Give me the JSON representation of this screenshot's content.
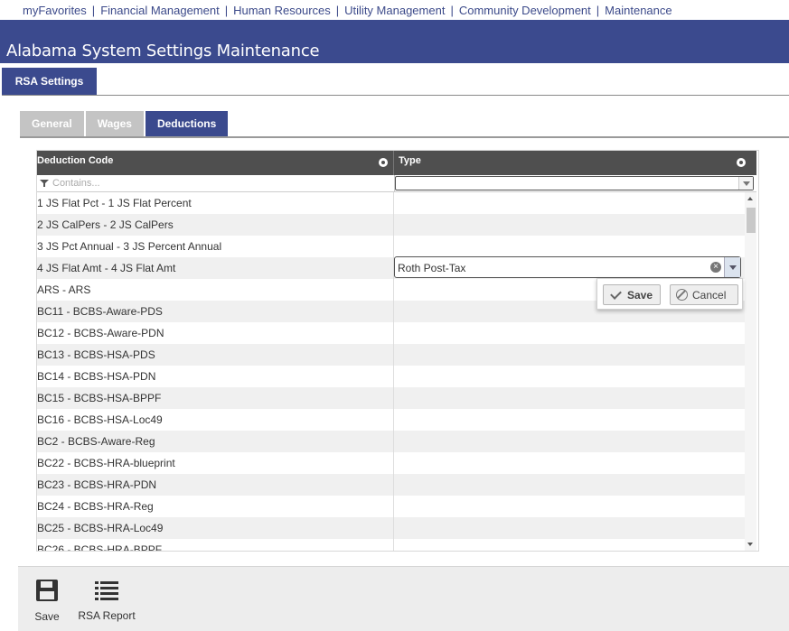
{
  "topnav": {
    "items": [
      "myFavorites",
      "Financial Management",
      "Human Resources",
      "Utility Management",
      "Community Development",
      "Maintenance"
    ],
    "separator": "|"
  },
  "page_title": "Alabama System Settings Maintenance",
  "main_tab": "RSA Settings",
  "subtabs": {
    "general": "General",
    "wages": "Wages",
    "deductions": "Deductions",
    "active": "Deductions"
  },
  "grid": {
    "columns": {
      "code": "Deduction Code",
      "type": "Type"
    },
    "filter_placeholder": "Contains...",
    "rows": [
      "1 JS Flat Pct - 1 JS Flat Percent",
      "2 JS CalPers - 2 JS CalPers",
      "3 JS Pct Annual - 3 JS Percent Annual",
      "4 JS Flat Amt - 4 JS Flat Amt",
      "ARS - ARS",
      "BC11 - BCBS-Aware-PDS",
      "BC12 - BCBS-Aware-PDN",
      "BC13 - BCBS-HSA-PDS",
      "BC14 - BCBS-HSA-PDN",
      "BC15 - BCBS-HSA-BPPF",
      "BC16 - BCBS-HSA-Loc49",
      "BC2 - BCBS-Aware-Reg",
      "BC22 - BCBS-HRA-blueprint",
      "BC23 - BCBS-HRA-PDN",
      "BC24 - BCBS-HRA-Reg",
      "BC25 - BCBS-HRA-Loc49",
      "BC26 - BCBS-HRA-BPPF"
    ]
  },
  "editor": {
    "value": "Roth Post-Tax",
    "clear_symbol": "×",
    "save_label": "Save",
    "cancel_label": "Cancel"
  },
  "toolbar": {
    "save_label": "Save",
    "report_label": "RSA Report"
  },
  "colors": {
    "brand": "#3b4a8e",
    "header": "#4f4f4f"
  }
}
